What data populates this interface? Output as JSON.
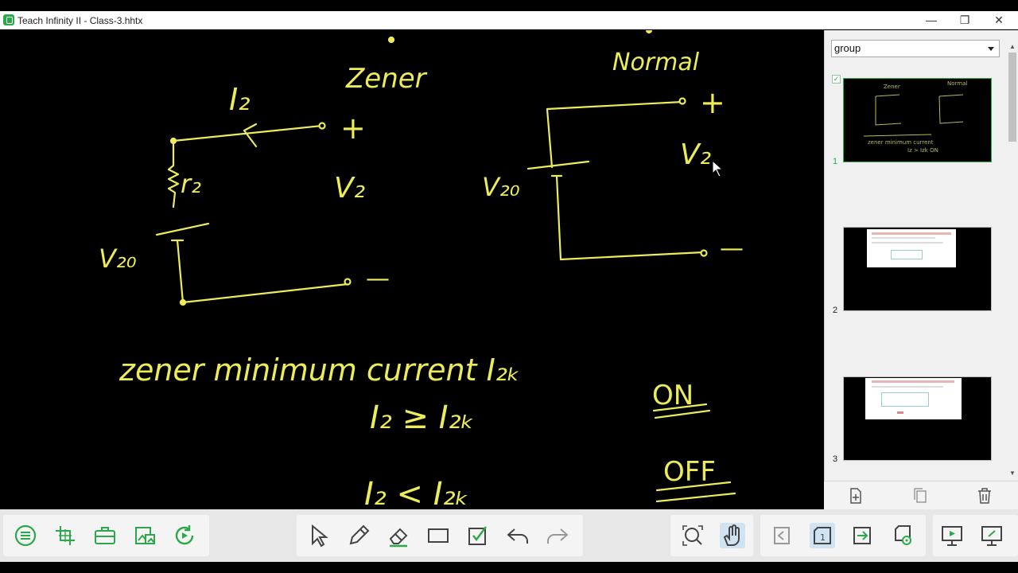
{
  "window": {
    "title": "Teach Infinity II - Class-3.hhtx",
    "minimize_glyph": "—",
    "restore_glyph": "❐",
    "close_glyph": "✕"
  },
  "board": {
    "ink_color": "#ecec5a",
    "background": "#000000",
    "left_circuit": {
      "heading": "Zener",
      "current_label": "I₂",
      "resistor_label": "r₂",
      "source_label": "V₂₀",
      "output_label": "V₂",
      "plus": "+",
      "minus": "—"
    },
    "right_circuit": {
      "heading": "Normal",
      "source_label": "V₂₀",
      "output_label": "V₂",
      "plus": "+",
      "minus": "—"
    },
    "line1": "zener minimum current I₂ₖ",
    "cond1_left": "I₂ ≥ I₂ₖ",
    "cond1_state": "ON",
    "cond2_left": "I₂ < I₂ₖ",
    "cond2_state": "OFF"
  },
  "sidebar": {
    "group_select": "group",
    "slides": [
      {
        "number": "1",
        "selected": true
      },
      {
        "number": "2",
        "selected": false
      },
      {
        "number": "3",
        "selected": false
      }
    ],
    "actions": [
      "add-page-icon",
      "copy-page-icon",
      "delete-icon"
    ]
  },
  "toolbar": {
    "accent": "#2aa84a",
    "left_tools": [
      "menu-icon",
      "crop-move-icon",
      "toolbox-icon",
      "insert-image-icon",
      "refresh-icon"
    ],
    "draw_tools": [
      "pointer-icon",
      "pen-icon",
      "eraser-icon",
      "rectangle-icon",
      "checkbox-icon",
      "undo-icon",
      "redo-icon"
    ],
    "view_tools": [
      "zoom-icon",
      "pan-hand-icon"
    ],
    "page_tools": [
      "previous-page-icon",
      "current-page-icon",
      "next-page-icon",
      "page-settings-icon"
    ],
    "current_page_number": "1",
    "present_tools": [
      "present-icon",
      "screen-share-icon"
    ]
  }
}
